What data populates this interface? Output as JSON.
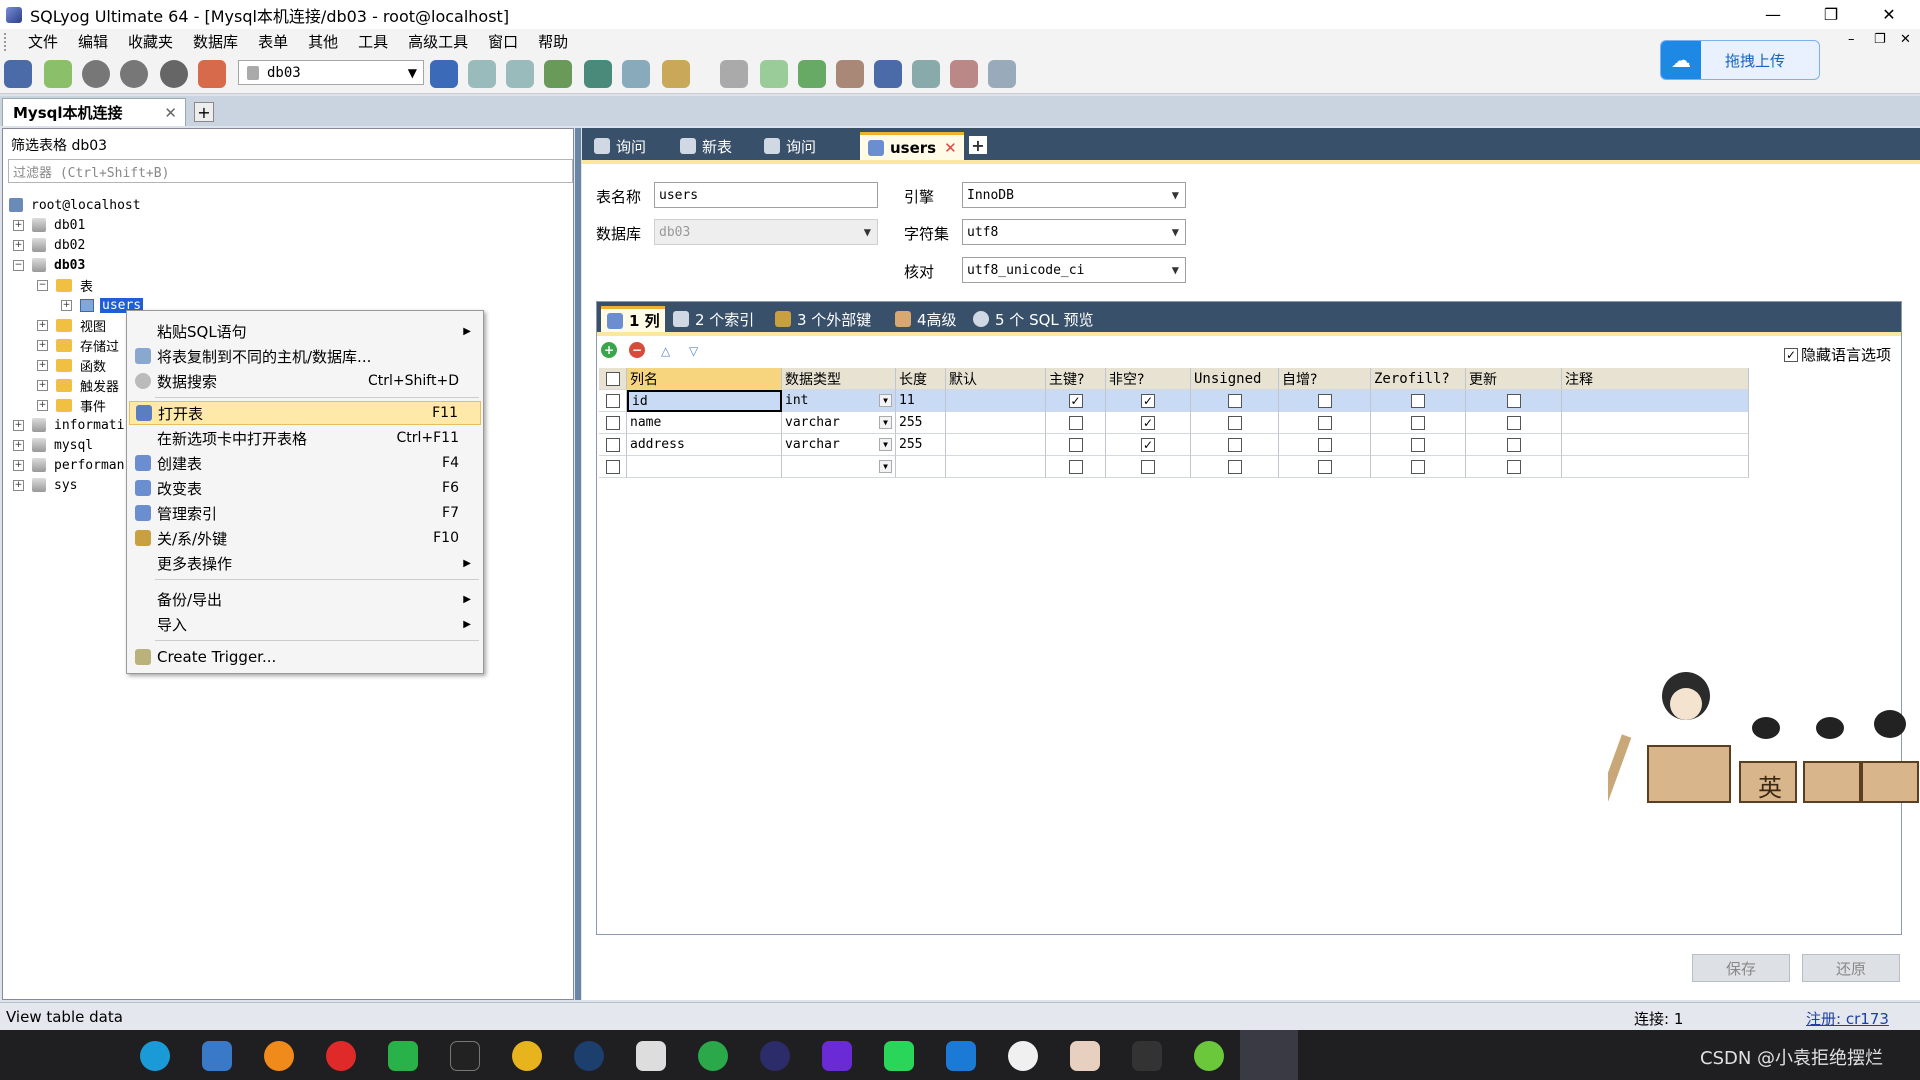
{
  "window": {
    "title": "SQLyog Ultimate 64 - [Mysql本机连接/db03 - root@localhost]",
    "minimize": "—",
    "maximize": "❐",
    "close": "✕"
  },
  "menu": [
    "文件",
    "编辑",
    "收藏夹",
    "数据库",
    "表单",
    "其他",
    "工具",
    "高级工具",
    "窗口",
    "帮助"
  ],
  "toolbar": {
    "db_selected": "db03",
    "upload_label": "拖拽上传",
    "mdi_min": "–",
    "mdi_restore": "❐",
    "mdi_close": "✕"
  },
  "connection_tab": {
    "label": "Mysql本机连接",
    "close": "✕",
    "add": "+"
  },
  "left_panel": {
    "filter_label": "筛选表格 db03",
    "filter_placeholder": "过滤器 (Ctrl+Shift+B)",
    "tree": {
      "root": "root@localhost",
      "db01": "db01",
      "db02": "db02",
      "db03": "db03",
      "tables": "表",
      "users": "users",
      "views": "视图",
      "procs": "存储过",
      "funcs": "函数",
      "triggers": "触发器",
      "events": "事件",
      "information": "informati",
      "mysql": "mysql",
      "performance": "performan",
      "sys": "sys"
    }
  },
  "context_menu": {
    "paste_sql": "粘贴SQL语句",
    "copy_table": "将表复制到不同的主机/数据库...",
    "data_search": "数据搜索",
    "data_search_sc": "Ctrl+Shift+D",
    "open_table": "打开表",
    "open_table_sc": "F11",
    "open_new_tab": "在新选项卡中打开表格",
    "open_new_tab_sc": "Ctrl+F11",
    "create_table": "创建表",
    "create_table_sc": "F4",
    "alter_table": "改变表",
    "alter_table_sc": "F6",
    "manage_index": "管理索引",
    "manage_index_sc": "F7",
    "relations": "关/系/外键",
    "relations_sc": "F10",
    "more_ops": "更多表操作",
    "backup_export": "备份/导出",
    "import": "导入",
    "create_trigger": "Create Trigger..."
  },
  "query_tabs": [
    {
      "label": "询问"
    },
    {
      "label": "新表"
    },
    {
      "label": "询问"
    },
    {
      "label": "users",
      "close": "✕"
    }
  ],
  "query_tab_add": "+",
  "table_form": {
    "name_label": "表名称",
    "name_value": "users",
    "db_label": "数据库",
    "db_value": "db03",
    "engine_label": "引擎",
    "engine_value": "InnoDB",
    "charset_label": "字符集",
    "charset_value": "utf8",
    "collation_label": "核对",
    "collation_value": "utf8_unicode_ci"
  },
  "sub_tabs": [
    "1 列",
    "2 个索引",
    "3 个外部键",
    "4高级",
    "5 个 SQL 预览"
  ],
  "hide_language_option": "隐藏语言选项",
  "grid": {
    "headers": [
      "列名",
      "数据类型",
      "长度",
      "默认",
      "主键?",
      "非空?",
      "Unsigned",
      "自增?",
      "Zerofill?",
      "更新",
      "注释"
    ],
    "rows": [
      {
        "name": "id",
        "type": "int",
        "length": "11",
        "pk": true,
        "notnull": true
      },
      {
        "name": "name",
        "type": "varchar",
        "length": "255",
        "pk": false,
        "notnull": true
      },
      {
        "name": "address",
        "type": "varchar",
        "length": "255",
        "pk": false,
        "notnull": true
      },
      {
        "name": "",
        "type": "",
        "length": "",
        "pk": false,
        "notnull": false
      }
    ]
  },
  "buttons": {
    "save": "保存",
    "revert": "还原"
  },
  "status": {
    "text": "View table data",
    "connections": "连接: 1",
    "registration": "注册: cr173"
  },
  "mascot": {
    "sign_text": "英"
  },
  "taskbar": {
    "watermark": "CSDN @小袁拒绝摆烂"
  }
}
